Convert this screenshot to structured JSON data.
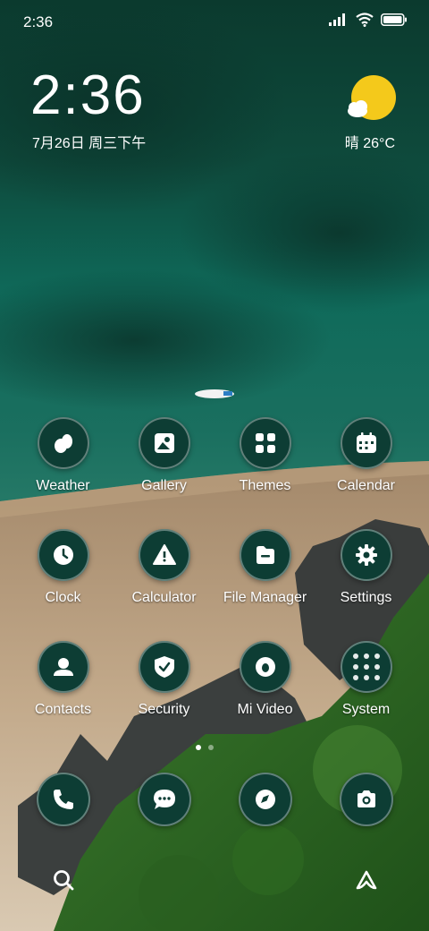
{
  "status_bar": {
    "time": "2:36",
    "icons": [
      "signal-icon",
      "wifi-icon",
      "battery-icon"
    ]
  },
  "clock_widget": {
    "time": "2:36",
    "date": "7月26日 周三下午"
  },
  "weather_widget": {
    "text": "晴 26°C",
    "icon": "sun-cloud-icon"
  },
  "apps": [
    {
      "label": "Weather",
      "icon": "weather-icon"
    },
    {
      "label": "Gallery",
      "icon": "gallery-icon"
    },
    {
      "label": "Themes",
      "icon": "themes-icon"
    },
    {
      "label": "Calendar",
      "icon": "calendar-icon"
    },
    {
      "label": "Clock",
      "icon": "clock-icon"
    },
    {
      "label": "Calculator",
      "icon": "calculator-icon"
    },
    {
      "label": "File Manager",
      "icon": "file-manager-icon"
    },
    {
      "label": "Settings",
      "icon": "settings-icon"
    },
    {
      "label": "Contacts",
      "icon": "contacts-icon"
    },
    {
      "label": "Security",
      "icon": "security-icon"
    },
    {
      "label": "Mi Video",
      "icon": "mi-video-icon"
    },
    {
      "label": "System",
      "icon": "system-folder-icon"
    }
  ],
  "dock": [
    {
      "icon": "phone-icon"
    },
    {
      "icon": "messages-icon"
    },
    {
      "icon": "browser-icon"
    },
    {
      "icon": "camera-icon"
    }
  ],
  "page_indicator": {
    "current": 1,
    "total": 2
  },
  "bottom_bar": {
    "left": "search-icon",
    "right": "app-vault-icon"
  }
}
